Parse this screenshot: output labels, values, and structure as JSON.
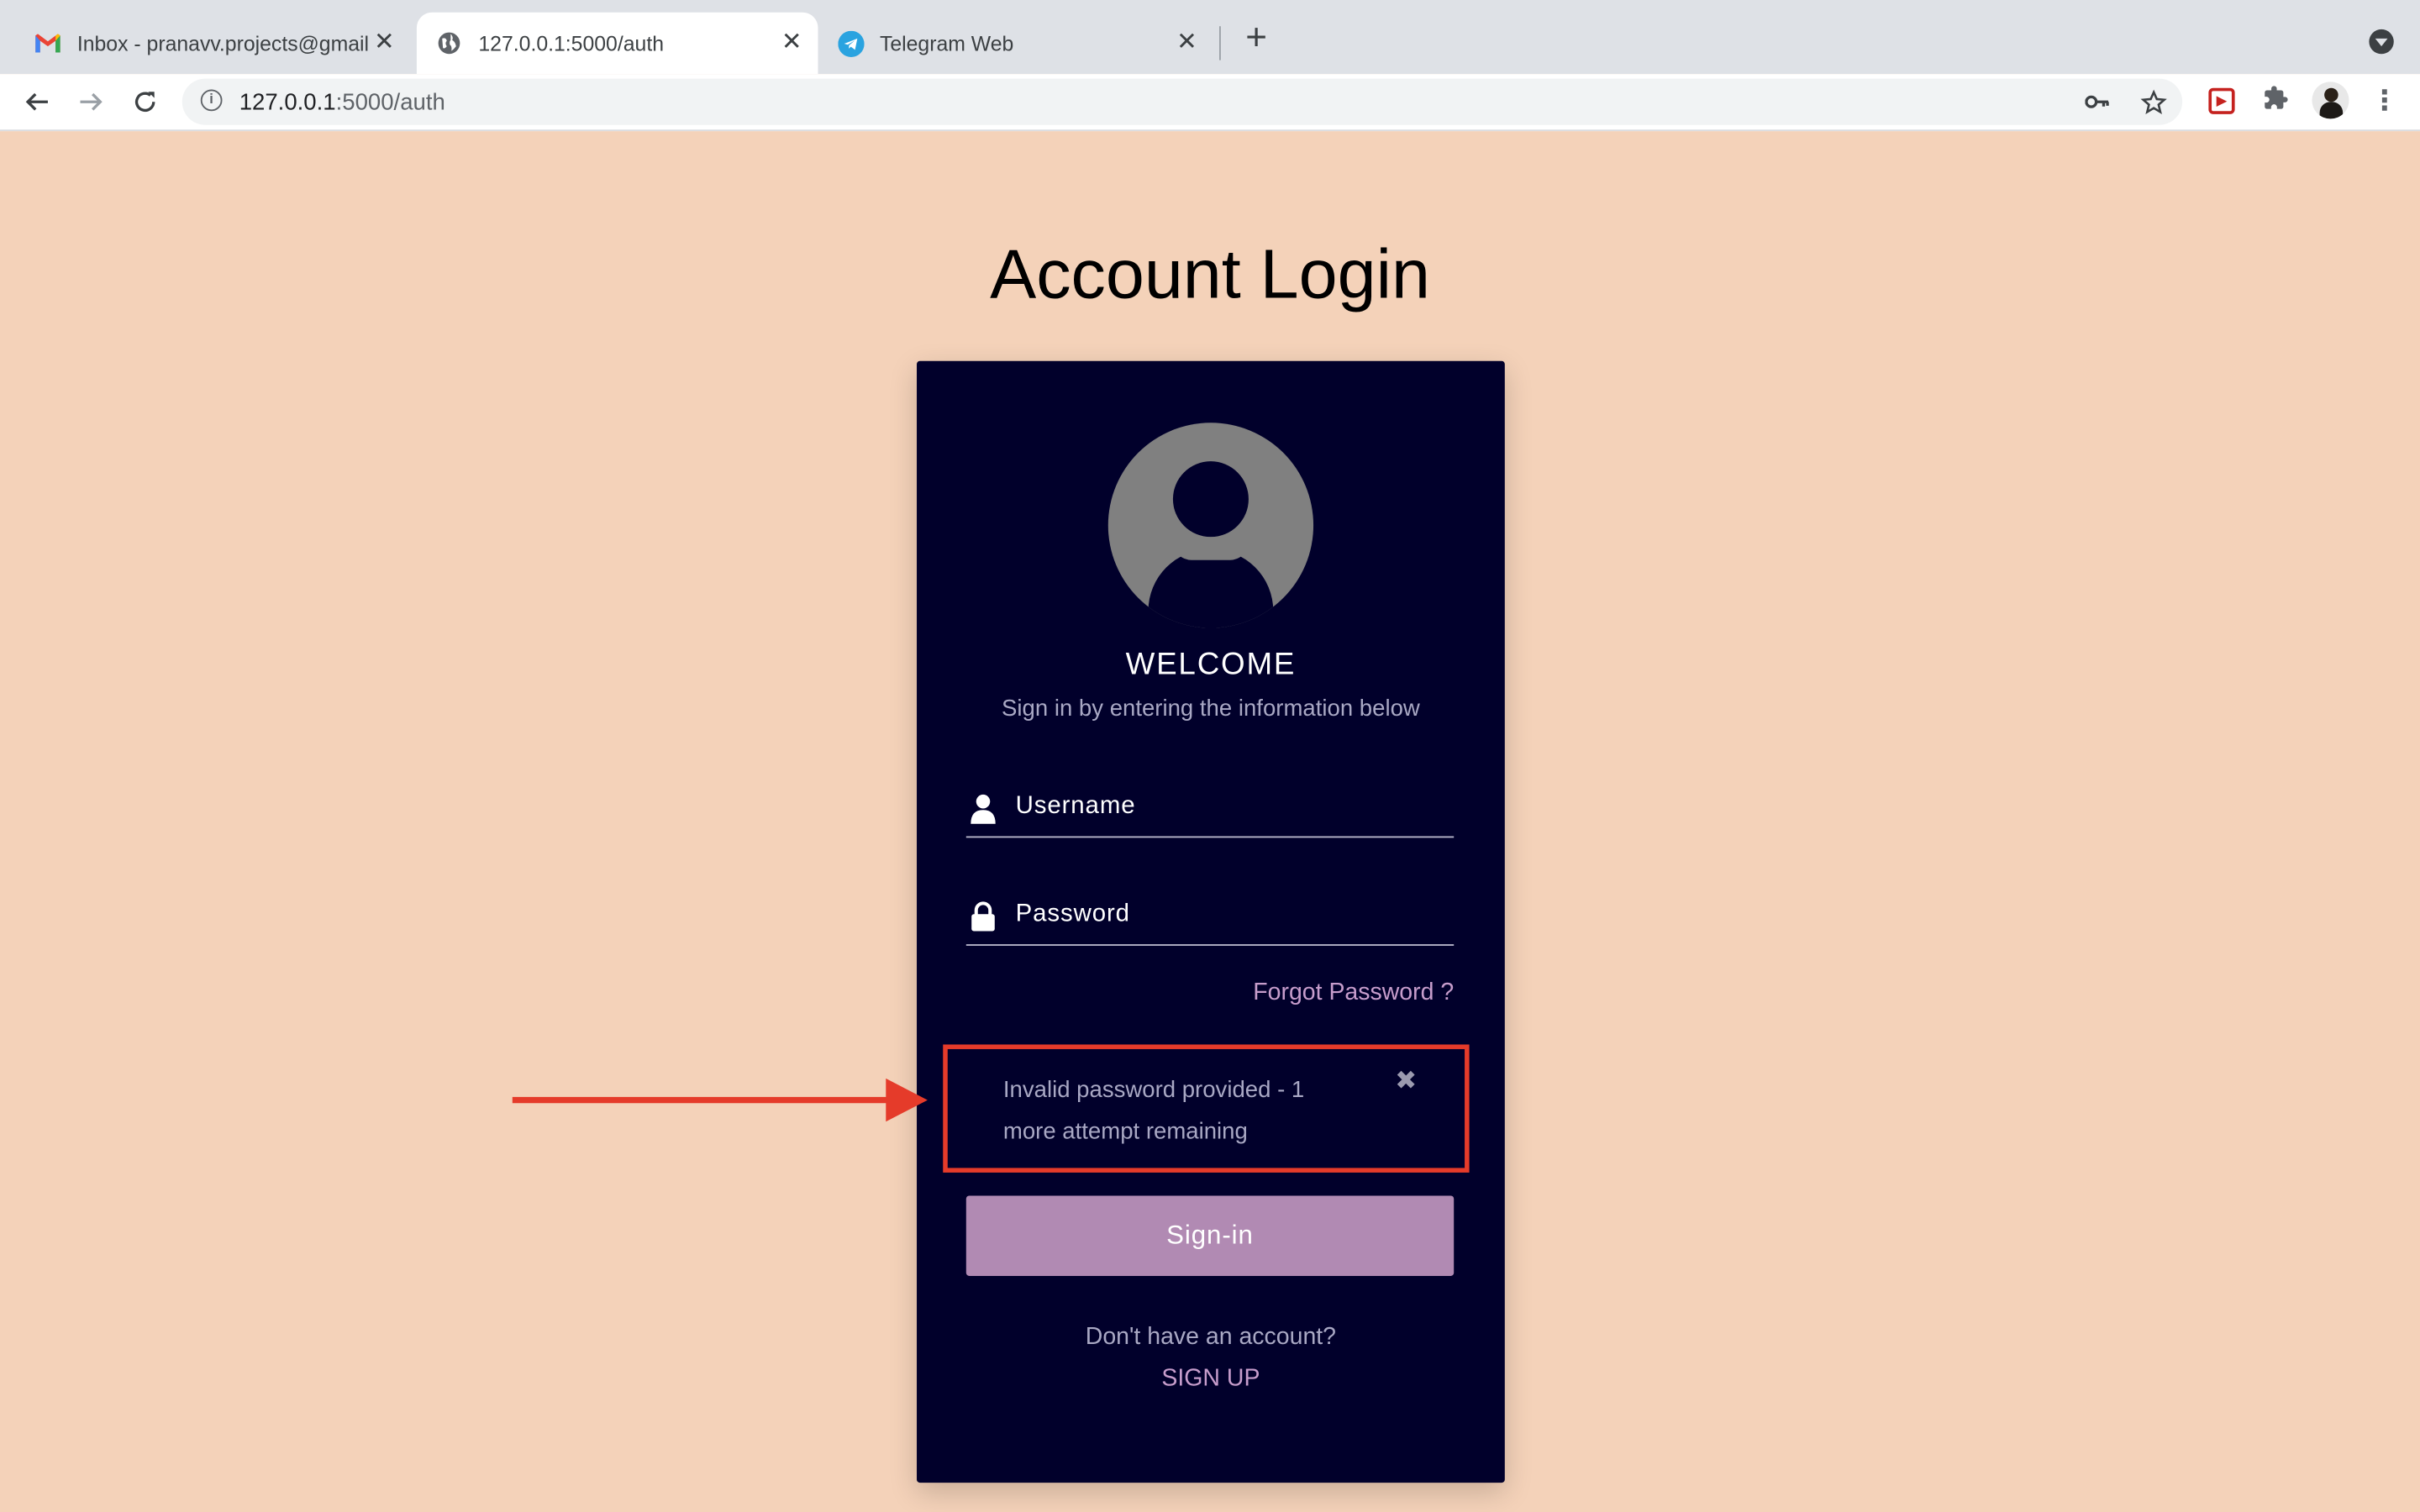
{
  "browser": {
    "tabs": [
      {
        "title": "Inbox - pranavv.projects@gmail.com",
        "icon": "gmail-icon",
        "active": false
      },
      {
        "title": "127.0.0.1:5000/auth",
        "icon": "globe-icon",
        "active": true
      },
      {
        "title": "Telegram Web",
        "icon": "telegram-icon",
        "active": false
      }
    ],
    "url_host": "127.0.0.1",
    "url_rest": ":5000/auth"
  },
  "page": {
    "title": "Account Login"
  },
  "card": {
    "welcome": "WELCOME",
    "subtitle": "Sign in by entering the information below",
    "username_placeholder": "Username",
    "password_placeholder": "Password",
    "forgot": "Forgot Password ?",
    "alert_message": "Invalid password provided - 1 more attempt remaining",
    "signin_label": "Sign-in",
    "no_account": "Don't have an account?",
    "signup_label": "SIGN UP"
  },
  "colors": {
    "page_bg": "#f4d2b9",
    "card_bg": "#01002b",
    "accent": "#b18ab3",
    "link": "#c79dcc",
    "annotation": "#e53b2a"
  }
}
